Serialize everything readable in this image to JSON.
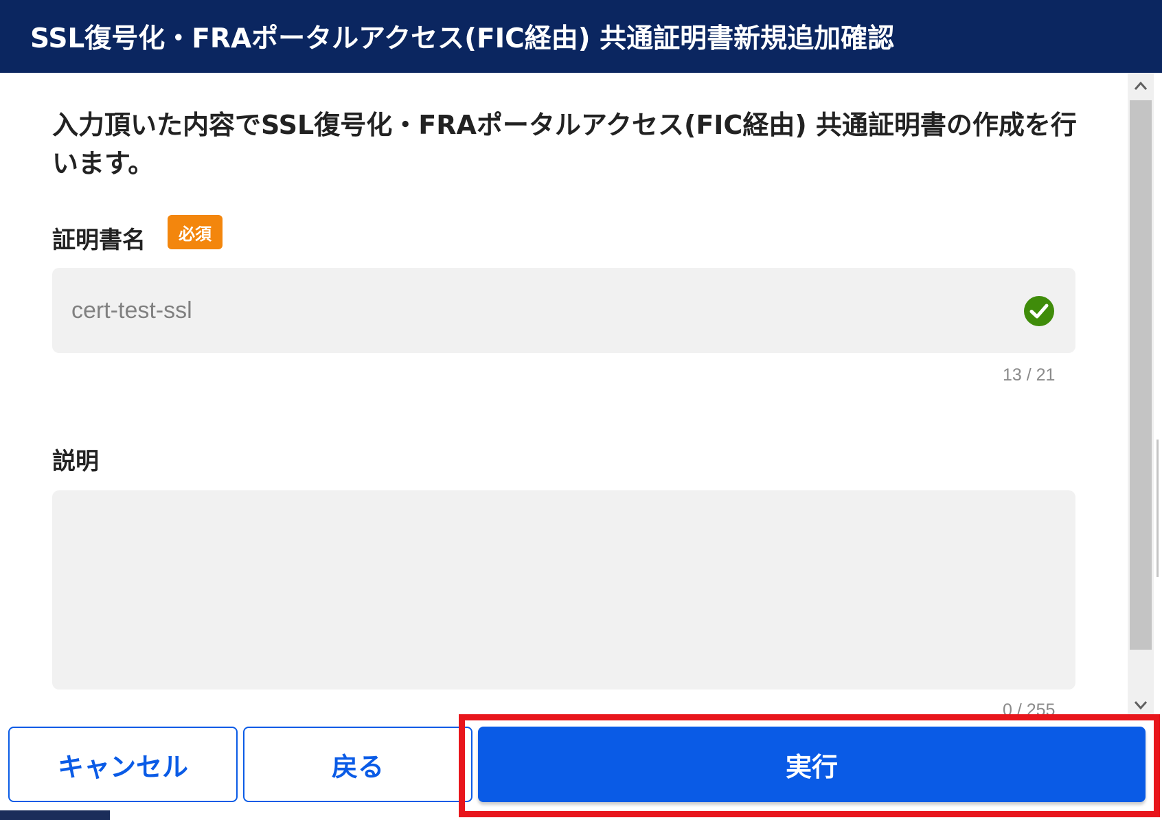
{
  "dialog": {
    "title": "SSL復号化・FRAポータルアクセス(FIC経由) 共通証明書新規追加確認",
    "lead": "入力頂いた内容でSSL復号化・FRAポータルアクセス(FIC経由) 共通証明書の作成を行います。"
  },
  "form": {
    "name": {
      "label": "証明書名",
      "required_badge": "必須",
      "value": "cert-test-ssl",
      "counter": "13 / 21",
      "status_icon": "check-circle-icon"
    },
    "description": {
      "label": "説明",
      "value": "",
      "counter": "0 / 255"
    }
  },
  "buttons": {
    "cancel": "キャンセル",
    "back": "戻る",
    "execute": "実行"
  },
  "colors": {
    "header_bg": "#0b2660",
    "primary": "#0a5be6",
    "required": "#f3860d",
    "success": "#3f8c0a",
    "highlight": "#e8161c"
  }
}
